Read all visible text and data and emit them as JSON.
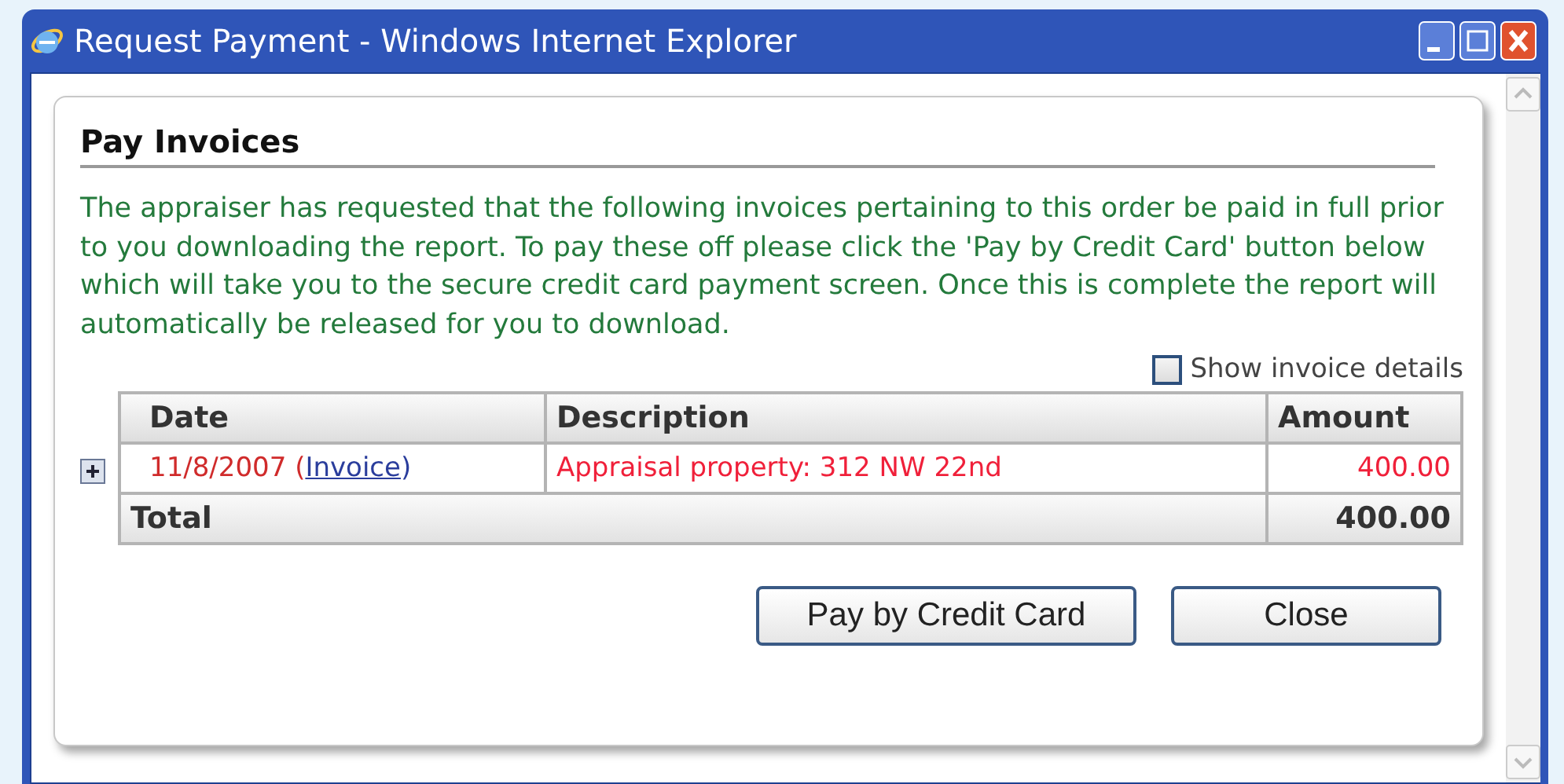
{
  "window": {
    "title": "Request Payment - Windows Internet Explorer"
  },
  "panel": {
    "heading": "Pay Invoices",
    "message": "The appraiser has requested that the following invoices pertaining to this order be paid in full prior to you downloading the report. To pay these off please click the 'Pay by Credit Card' button below which will take you to the secure credit card payment screen. Once this is complete the report will automatically be released for you to download.",
    "show_details": {
      "label": "Show invoice details",
      "checked": false
    },
    "table": {
      "columns": [
        "Date",
        "Description",
        "Amount"
      ],
      "rows": [
        {
          "expanded": false,
          "date": "11/8/2007 (",
          "link": "Invoice",
          "date_end": ")",
          "description": "Appraisal property: 312 NW 22nd",
          "amount": "400.00"
        }
      ],
      "total": {
        "label": "Total",
        "amount": "400.00"
      }
    },
    "buttons": [
      "Pay by Credit Card",
      "Close"
    ]
  }
}
